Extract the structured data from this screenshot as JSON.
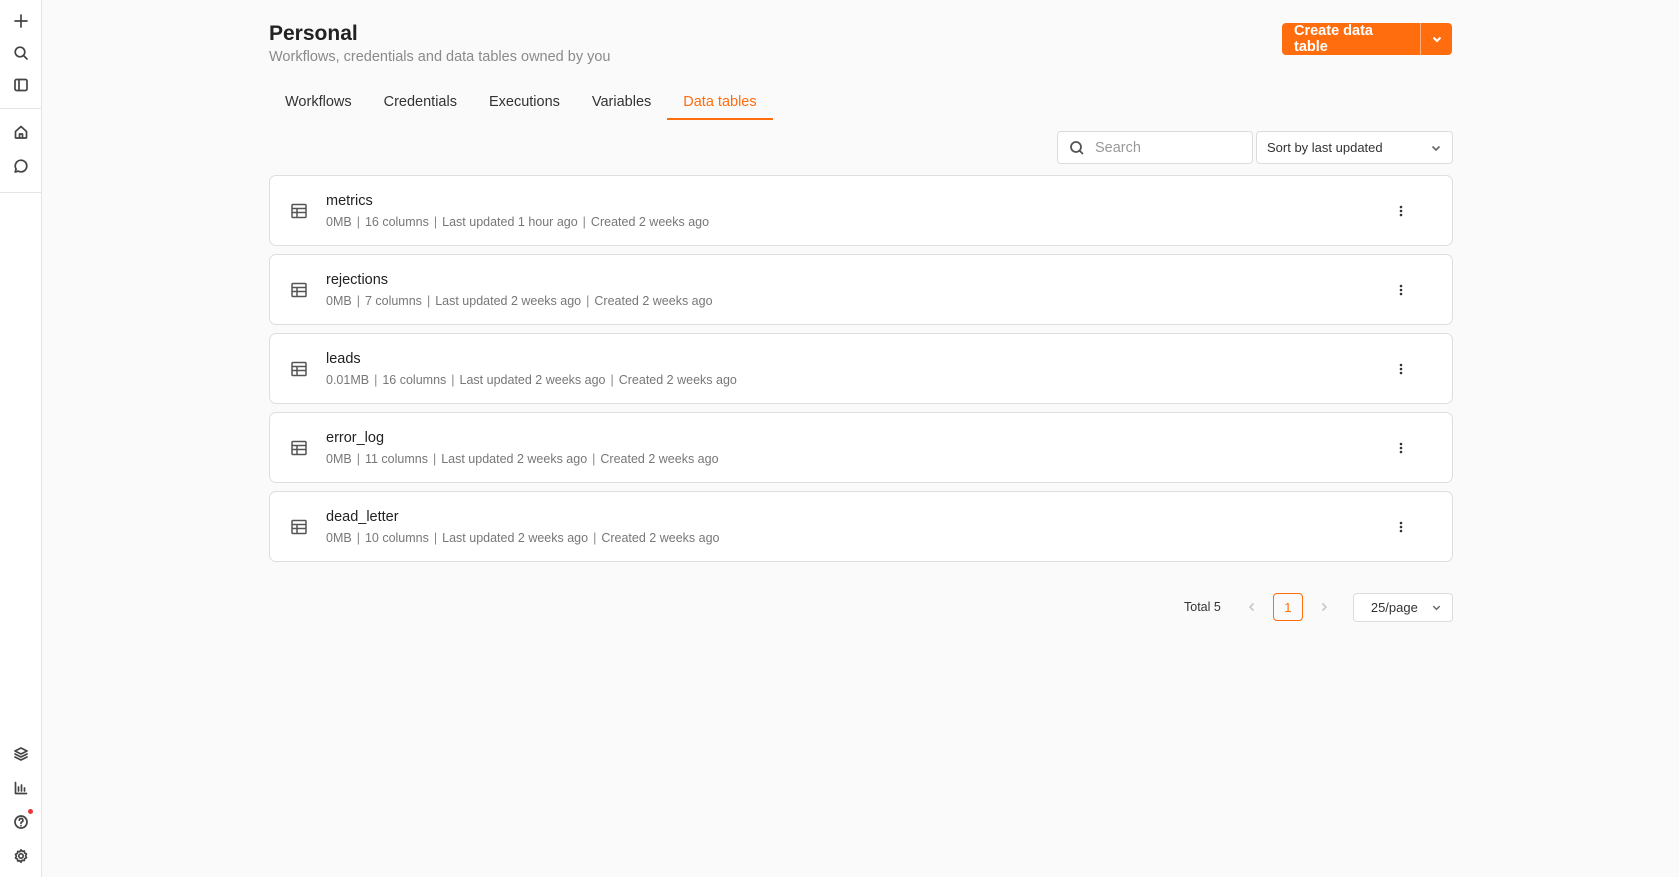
{
  "sidebar": {
    "top_icons": [
      "plus-icon",
      "search-icon",
      "sidebar-toggle-icon"
    ],
    "nav_icons": [
      "home-icon",
      "chat-icon"
    ],
    "bottom_icons": [
      "templates-icon",
      "insights-icon",
      "help-icon",
      "settings-icon"
    ]
  },
  "header": {
    "title": "Personal",
    "subtitle": "Workflows, credentials and data tables owned by you",
    "create_label": "Create data table"
  },
  "tabs": [
    {
      "label": "Workflows",
      "active": false
    },
    {
      "label": "Credentials",
      "active": false
    },
    {
      "label": "Executions",
      "active": false
    },
    {
      "label": "Variables",
      "active": false
    },
    {
      "label": "Data tables",
      "active": true
    }
  ],
  "toolbar": {
    "search_placeholder": "Search",
    "search_value": "",
    "sort_label": "Sort by last updated"
  },
  "tables": [
    {
      "name": "metrics",
      "size": "0MB",
      "columns": "16 columns",
      "updated": "Last updated 1 hour ago",
      "created": "Created 2 weeks ago"
    },
    {
      "name": "rejections",
      "size": "0MB",
      "columns": "7 columns",
      "updated": "Last updated 2 weeks ago",
      "created": "Created 2 weeks ago"
    },
    {
      "name": "leads",
      "size": "0.01MB",
      "columns": "16 columns",
      "updated": "Last updated 2 weeks ago",
      "created": "Created 2 weeks ago"
    },
    {
      "name": "error_log",
      "size": "0MB",
      "columns": "11 columns",
      "updated": "Last updated 2 weeks ago",
      "created": "Created 2 weeks ago"
    },
    {
      "name": "dead_letter",
      "size": "0MB",
      "columns": "10 columns",
      "updated": "Last updated 2 weeks ago",
      "created": "Created 2 weeks ago"
    }
  ],
  "pagination": {
    "total": "Total 5",
    "current_page": "1",
    "page_size": "25/page"
  },
  "colors": {
    "accent": "#ff6d0e",
    "notification_dot": "#e5383b"
  }
}
